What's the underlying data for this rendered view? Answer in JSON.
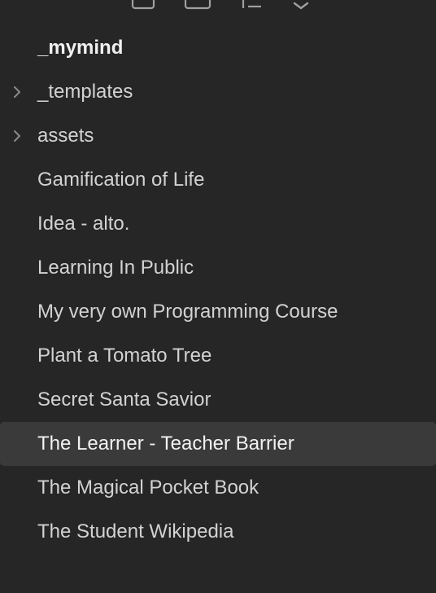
{
  "vault": {
    "name": "_mymind"
  },
  "toolbar": {
    "icons": [
      "new-note-icon",
      "new-folder-icon",
      "sort-icon",
      "collapse-icon"
    ]
  },
  "tree": {
    "folders": [
      {
        "label": "_templates",
        "icon": "chevron-right-icon"
      },
      {
        "label": "assets",
        "icon": "chevron-right-icon"
      }
    ],
    "files": [
      {
        "label": "Gamification of Life"
      },
      {
        "label": "Idea - alto."
      },
      {
        "label": "Learning In Public"
      },
      {
        "label": "My very own Programming Course"
      },
      {
        "label": "Plant a Tomato Tree"
      },
      {
        "label": "Secret Santa Savior"
      },
      {
        "label": "The Learner - Teacher Barrier",
        "active": true
      },
      {
        "label": "The Magical Pocket Book"
      },
      {
        "label": "The Student Wikipedia"
      }
    ]
  },
  "colors": {
    "background": "#262626",
    "active_row": "#3a3a3a",
    "text": "#d2d2d2",
    "chevron": "#8a8a8a"
  }
}
